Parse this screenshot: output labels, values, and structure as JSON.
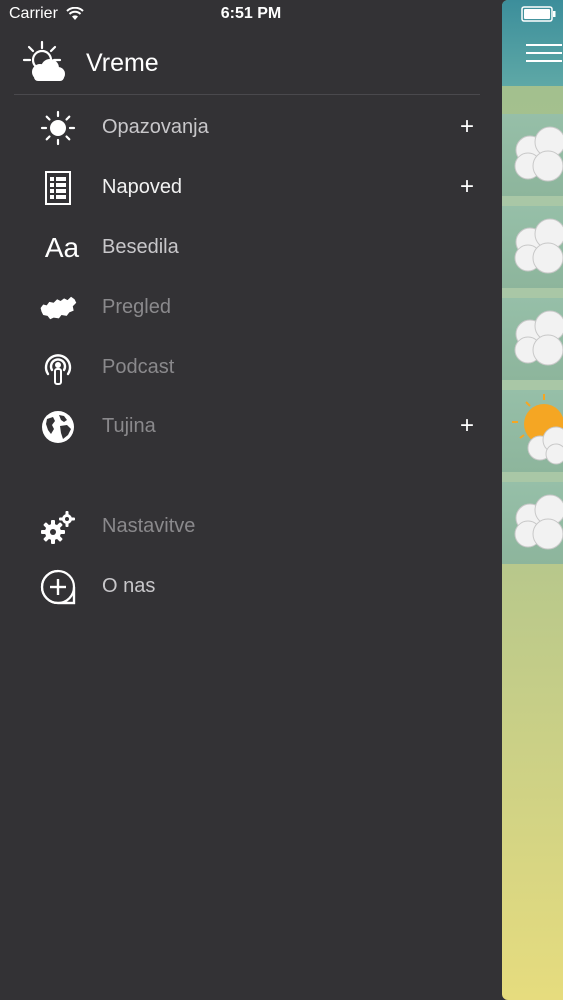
{
  "status_bar": {
    "carrier": "Carrier",
    "time": "6:51 PM"
  },
  "header": {
    "title": "Vreme",
    "icon": "sun-cloud-icon"
  },
  "menu": [
    {
      "label": "Opazovanja",
      "icon": "sun-icon",
      "state": "normal",
      "has_plus": true
    },
    {
      "label": "Napoved",
      "icon": "table-list-icon",
      "state": "active",
      "has_plus": true
    },
    {
      "label": "Besedila",
      "icon": "font-aa-icon",
      "state": "normal",
      "has_plus": false
    },
    {
      "label": "Pregled",
      "icon": "slovenia-map-icon",
      "state": "inactive",
      "has_plus": false
    },
    {
      "label": "Podcast",
      "icon": "podcast-icon",
      "state": "inactive",
      "has_plus": false
    },
    {
      "label": "Tujina",
      "icon": "globe-icon",
      "state": "inactive",
      "has_plus": true
    },
    {
      "label": "Nastavitve",
      "icon": "gears-icon",
      "state": "inactive",
      "has_plus": false
    },
    {
      "label": "O nas",
      "icon": "plus-bubble-icon",
      "state": "normal",
      "has_plus": false
    }
  ],
  "icons_text": {
    "aa": "Aa"
  },
  "plus_symbol": "+",
  "colors": {
    "drawer_bg": "#333235",
    "active_text": "#f2f2f2",
    "inactive_text": "#8a898c",
    "accent_sun": "#f5a623"
  }
}
